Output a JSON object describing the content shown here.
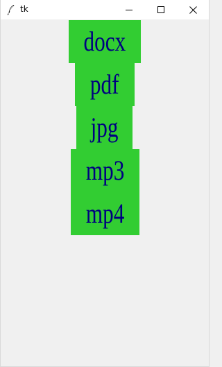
{
  "window": {
    "title": "tk",
    "icon": "feather-icon",
    "controls": {
      "minimize_icon": "minimize-icon",
      "maximize_icon": "maximize-icon",
      "close_icon": "close-icon"
    }
  },
  "colors": {
    "button_background": "#32cd32",
    "button_text": "#000080",
    "window_background": "#f0f0f0",
    "titlebar_background": "#ffffff"
  },
  "buttons": [
    {
      "label": "docx"
    },
    {
      "label": "pdf"
    },
    {
      "label": "jpg"
    },
    {
      "label": "mp3"
    },
    {
      "label": "mp4"
    }
  ]
}
